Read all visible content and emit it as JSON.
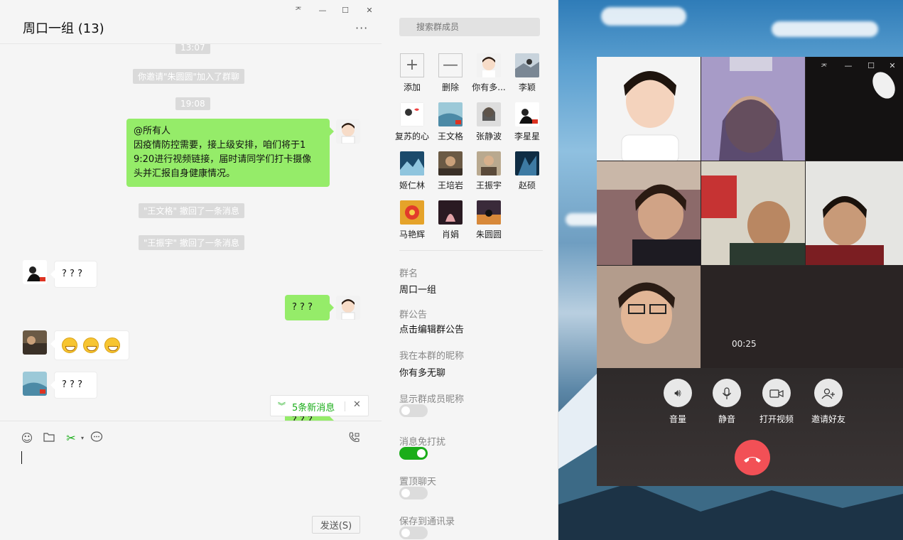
{
  "chat": {
    "title": "周口一组 (13)",
    "more": "···",
    "window_buttons": {
      "pin": "ᅎ",
      "min": "—",
      "max": "☐",
      "close": "✕"
    },
    "messages": {
      "time1": "13:07",
      "sys_invite": "你邀请\"朱圆圆\"加入了群聊",
      "time2": "19:08",
      "announce_line1": "@所有人",
      "announce_line2": "因疫情防控需要，接上级安排，咱们将于1",
      "announce_line3": "9:20进行视频链接，届时请同学们打卡摄像",
      "announce_line4": "头并汇报自身健康情况。",
      "sys_recall1": "\"王文格\" 撤回了一条消息",
      "sys_recall2": "\"王振宇\" 撤回了一条消息",
      "q1": "? ? ?",
      "q_me": "? ? ?",
      "q2": "? ? ?",
      "q_partial": "? ? ?"
    },
    "new_messages": {
      "label": "5条新消息",
      "close": "✕"
    },
    "send_button": "发送(S)"
  },
  "panel": {
    "search_placeholder": "搜索群成员",
    "members": [
      {
        "name": "添加"
      },
      {
        "name": "删除"
      },
      {
        "name": "你有多..."
      },
      {
        "name": "李颖"
      },
      {
        "name": "复苏的心"
      },
      {
        "name": "王文格"
      },
      {
        "name": "张静波"
      },
      {
        "name": "李星星"
      },
      {
        "name": "姬仁林"
      },
      {
        "name": "王培岩"
      },
      {
        "name": "王振宇"
      },
      {
        "name": "赵硕"
      },
      {
        "name": "马艳辉"
      },
      {
        "name": "肖娟"
      },
      {
        "name": "朱圆圆"
      }
    ],
    "group_name_label": "群名",
    "group_name_value": "周口一组",
    "notice_label": "群公告",
    "notice_value": "点击编辑群公告",
    "nickname_label": "我在本群的昵称",
    "nickname_value": "你有多无聊",
    "show_nick_label": "显示群成员昵称",
    "dnd_label": "消息免打扰",
    "pin_label": "置顶聊天",
    "save_label": "保存到通讯录",
    "toggles": {
      "show_nick": false,
      "dnd": true,
      "pin": false,
      "save": false
    }
  },
  "call": {
    "timer": "00:25",
    "controls": [
      {
        "label": "音量",
        "icon": "speaker-icon"
      },
      {
        "label": "静音",
        "icon": "mic-icon"
      },
      {
        "label": "打开视频",
        "icon": "video-icon"
      },
      {
        "label": "邀请好友",
        "icon": "add-user-icon"
      }
    ]
  },
  "colors": {
    "accent": "#1aad19",
    "bubble_me": "#95ec69",
    "hangup": "#f25056"
  }
}
